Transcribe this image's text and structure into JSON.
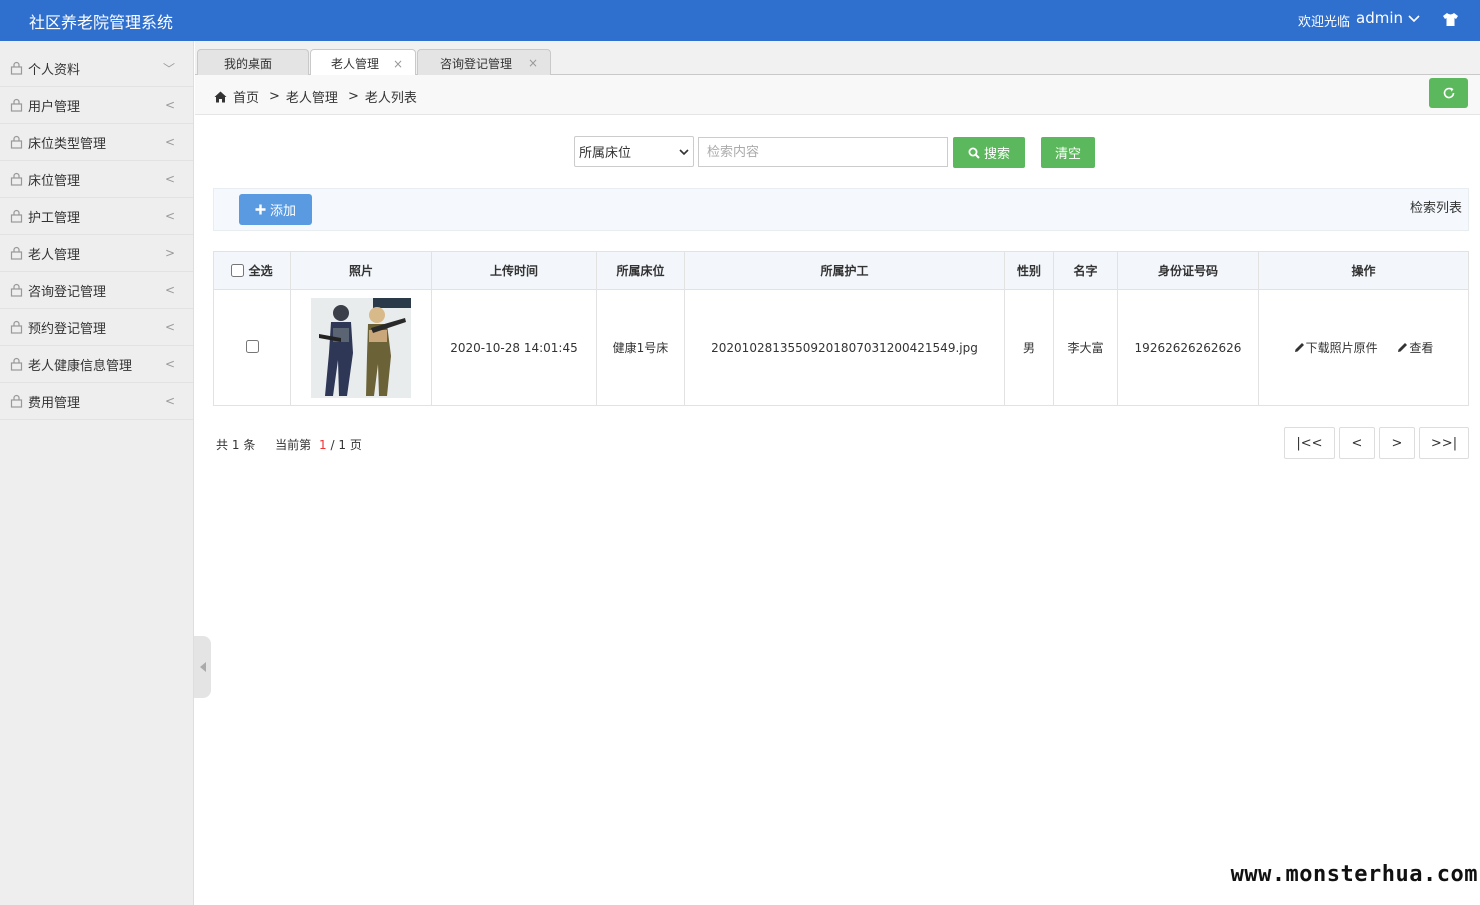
{
  "header": {
    "title": "社区养老院管理系统",
    "welcome": "欢迎光临",
    "username": "admin"
  },
  "sidebar": {
    "items": [
      {
        "label": "个人资料",
        "arrow": "﹀"
      },
      {
        "label": "用户管理",
        "arrow": "<"
      },
      {
        "label": "床位类型管理",
        "arrow": "<"
      },
      {
        "label": "床位管理",
        "arrow": "<"
      },
      {
        "label": "护工管理",
        "arrow": "<"
      },
      {
        "label": "老人管理",
        "arrow": ">"
      },
      {
        "label": "咨询登记管理",
        "arrow": "<"
      },
      {
        "label": "预约登记管理",
        "arrow": "<"
      },
      {
        "label": "老人健康信息管理",
        "arrow": "<"
      },
      {
        "label": "费用管理",
        "arrow": "<"
      }
    ]
  },
  "tabs": [
    {
      "label": "我的桌面",
      "close": ""
    },
    {
      "label": "老人管理",
      "close": "×"
    },
    {
      "label": "咨询登记管理",
      "close": "×"
    }
  ],
  "breadcrumb": {
    "home": "首页",
    "sep": ">",
    "level1": "老人管理",
    "level2": "老人列表"
  },
  "search": {
    "select_value": "所属床位",
    "placeholder": "检索内容",
    "search_label": "搜索",
    "clear_label": "清空"
  },
  "toolbar": {
    "add_label": "添加",
    "title": "检索列表"
  },
  "table": {
    "headers": [
      "全选",
      "照片",
      "上传时间",
      "所属床位",
      "所属护工",
      "性别",
      "名字",
      "身份证号码",
      "操作"
    ],
    "rows": [
      {
        "upload_time": "2020-10-28 14:01:45",
        "bed": "健康1号床",
        "nurse": "20201028135509201807031200421549.jpg",
        "gender": "男",
        "name": "李大富",
        "id_number": "19262626262626",
        "op_download": "下载照片原件",
        "op_view": "查看"
      }
    ]
  },
  "pagination": {
    "total_prefix": "共",
    "total": "1",
    "total_suffix": "条",
    "current_prefix": "当前第",
    "current": "1",
    "divider": "/",
    "pages": "1",
    "pages_suffix": "页",
    "first": "|<<",
    "prev": "<",
    "next": ">",
    "last": ">>|"
  },
  "watermark": "www.monsterhua.com",
  "colors": {
    "header": "#2f6fce",
    "green": "#5cb85c",
    "blue_button": "#5a9ae0",
    "page_current": "#ee3333"
  }
}
